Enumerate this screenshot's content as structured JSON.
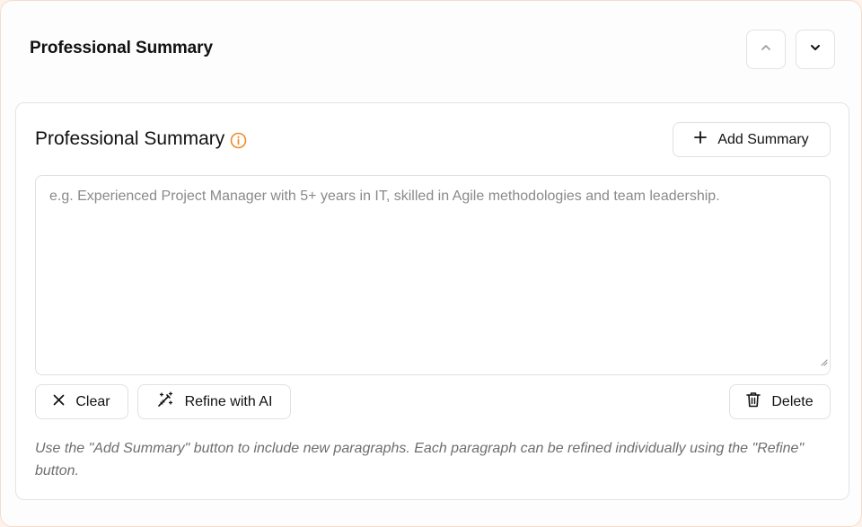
{
  "section": {
    "title": "Professional Summary",
    "move_up_icon": "chevron-up-icon",
    "move_down_icon": "chevron-down-icon"
  },
  "card": {
    "title": "Professional Summary",
    "info_icon": "info-icon",
    "add_button_label": "Add Summary",
    "textarea": {
      "value": "",
      "placeholder": "e.g. Experienced Project Manager with 5+ years in IT, skilled in Agile methodologies and team leadership."
    },
    "clear_label": "Clear",
    "refine_label": "Refine with AI",
    "delete_label": "Delete",
    "hint": "Use the \"Add Summary\" button to include new paragraphs. Each paragraph can be refined individually using the \"Refine\" button."
  },
  "colors": {
    "accent": "#f08a24",
    "outer_border": "#f6dccb"
  }
}
